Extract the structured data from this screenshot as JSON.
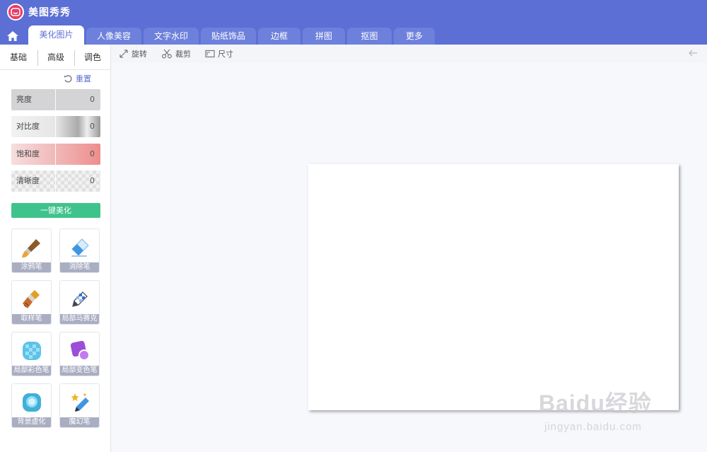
{
  "app": {
    "title": "美图秀秀"
  },
  "tabs": [
    {
      "label": "美化图片"
    },
    {
      "label": "人像美容"
    },
    {
      "label": "文字水印"
    },
    {
      "label": "贴纸饰品"
    },
    {
      "label": "边框"
    },
    {
      "label": "拼图"
    },
    {
      "label": "抠图"
    },
    {
      "label": "更多"
    }
  ],
  "subtabs": [
    {
      "label": "基础"
    },
    {
      "label": "高级"
    },
    {
      "label": "调色"
    }
  ],
  "reset_label": "重置",
  "adjustments": [
    {
      "label": "亮度",
      "value": "0"
    },
    {
      "label": "对比度",
      "value": "0"
    },
    {
      "label": "饱和度",
      "value": "0"
    },
    {
      "label": "清晰度",
      "value": "0"
    }
  ],
  "one_click_label": "一键美化",
  "tools": [
    {
      "label": "涂鸦笔",
      "icon": "paintbrush-icon"
    },
    {
      "label": "消除笔",
      "icon": "eraser-icon"
    },
    {
      "label": "取样笔",
      "icon": "sample-brush-icon"
    },
    {
      "label": "局部马赛克",
      "icon": "mosaic-pen-icon"
    },
    {
      "label": "局部彩色笔",
      "icon": "color-pen-icon"
    },
    {
      "label": "局部变色笔",
      "icon": "recolor-pen-icon"
    },
    {
      "label": "背景虚化",
      "icon": "blur-icon"
    },
    {
      "label": "魔幻笔",
      "icon": "magic-pen-icon"
    }
  ],
  "toolbar": {
    "rotate_label": "旋转",
    "crop_label": "裁剪",
    "size_label": "尺寸"
  },
  "watermark": {
    "main": "Baidu经验",
    "sub": "jingyan.baidu.com"
  },
  "colors": {
    "brand": "#5b6fd4",
    "tab_inactive": "#6d80dc",
    "accent_green": "#3fc38d",
    "logo_red": "#e83a66"
  }
}
